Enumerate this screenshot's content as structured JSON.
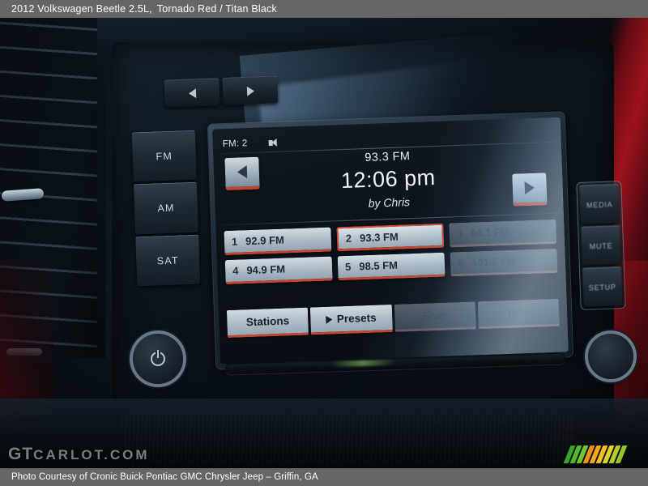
{
  "header": {
    "vehicle": "2012 Volkswagen Beetle 2.5L,",
    "colors": "Tornado Red / Titan Black"
  },
  "footer": {
    "credit": "Photo Courtesy of Cronic Buick Pontiac GMC Chrysler Jeep – Griffin, GA"
  },
  "watermark": {
    "brand_main": "GT",
    "brand_rest": "CARLOT.COM",
    "logo_colors": [
      "#3aa32a",
      "#4fb82f",
      "#6fc52f",
      "#e8941a",
      "#f0a81e",
      "#f2bd22",
      "#d9d32a",
      "#b6cc2a",
      "#93c42a"
    ]
  },
  "radio": {
    "screen": {
      "band_label": "FM: 2",
      "speaker_icon": "speaker-icon",
      "station_frequency": "93.3 FM",
      "clock": "12:06 pm",
      "artist": "by Chris",
      "prev_icon": "triangle-left-icon",
      "next_icon": "triangle-right-icon"
    },
    "presets": [
      {
        "num": "1",
        "freq": "92.9 FM",
        "state": "normal"
      },
      {
        "num": "2",
        "freq": "93.3 FM",
        "state": "selected"
      },
      {
        "num": "3",
        "freq": "94.1 FM",
        "state": "dimmed"
      },
      {
        "num": "4",
        "freq": "94.9 FM",
        "state": "normal"
      },
      {
        "num": "5",
        "freq": "98.5 FM",
        "state": "normal"
      },
      {
        "num": "6",
        "freq": "101.5 FM",
        "state": "dimmed"
      }
    ],
    "tabs": [
      {
        "label": "Stations",
        "state": "normal",
        "icon": ""
      },
      {
        "label": "Presets",
        "state": "active",
        "icon": "triangle-right-icon"
      },
      {
        "label": "Scan",
        "state": "dimmed",
        "icon": ""
      },
      {
        "label": "Tune",
        "state": "dimmed",
        "icon": ""
      }
    ],
    "left_keys": [
      "FM",
      "AM",
      "SAT"
    ],
    "right_keys": [
      "MEDIA",
      "MUTE",
      "SETUP"
    ],
    "trim_buttons": [
      "seek-back-icon",
      "seek-forward-icon"
    ],
    "knobs": {
      "left": "power-volume-knob",
      "right": "tune-knob"
    }
  },
  "accent": {
    "button_red": "#c4442e",
    "bar_gray": "#666666",
    "screen_text": "#e6edf3"
  }
}
